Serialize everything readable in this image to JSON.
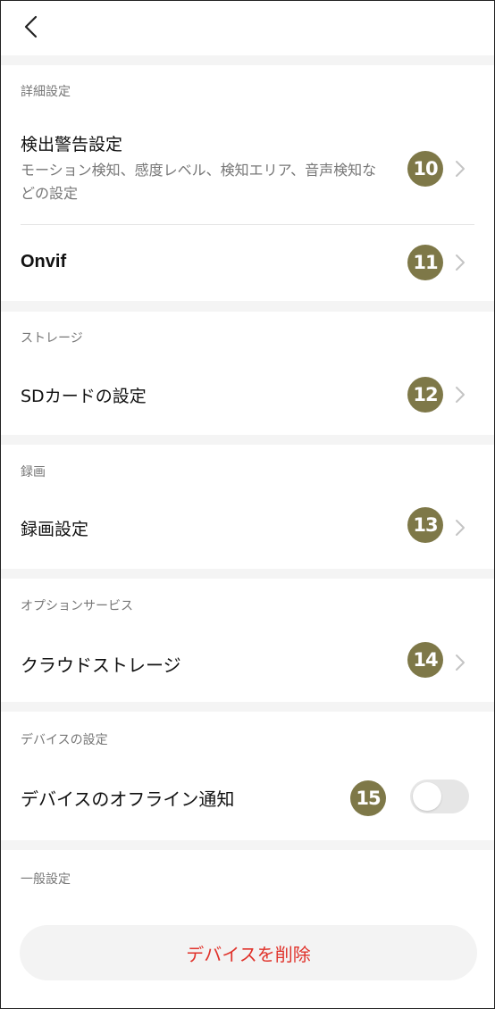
{
  "sections": {
    "detail": {
      "header": "詳細設定",
      "rows": [
        {
          "title": "検出警告設定",
          "desc": "モーション検知、感度レベル、検知エリア、音声検知などの設定",
          "badge": "10"
        },
        {
          "title": "Onvif",
          "badge": "11"
        }
      ]
    },
    "storage": {
      "header": "ストレージ",
      "rows": [
        {
          "title": "SDカードの設定",
          "badge": "12"
        }
      ]
    },
    "recording": {
      "header": "録画",
      "rows": [
        {
          "title": "録画設定",
          "badge": "13"
        }
      ]
    },
    "option": {
      "header": "オプションサービス",
      "rows": [
        {
          "title": "クラウドストレージ",
          "badge": "14"
        }
      ]
    },
    "device": {
      "header": "デバイスの設定",
      "rows": [
        {
          "title": "デバイスのオフライン通知",
          "badge": "15",
          "toggle_on": false
        }
      ]
    },
    "general": {
      "header": "一般設定"
    }
  },
  "delete_button": "デバイスを削除",
  "colors": {
    "badge": "#7e7848",
    "delete_text": "#e0322a",
    "toggle_off": "#e6e6e6"
  }
}
